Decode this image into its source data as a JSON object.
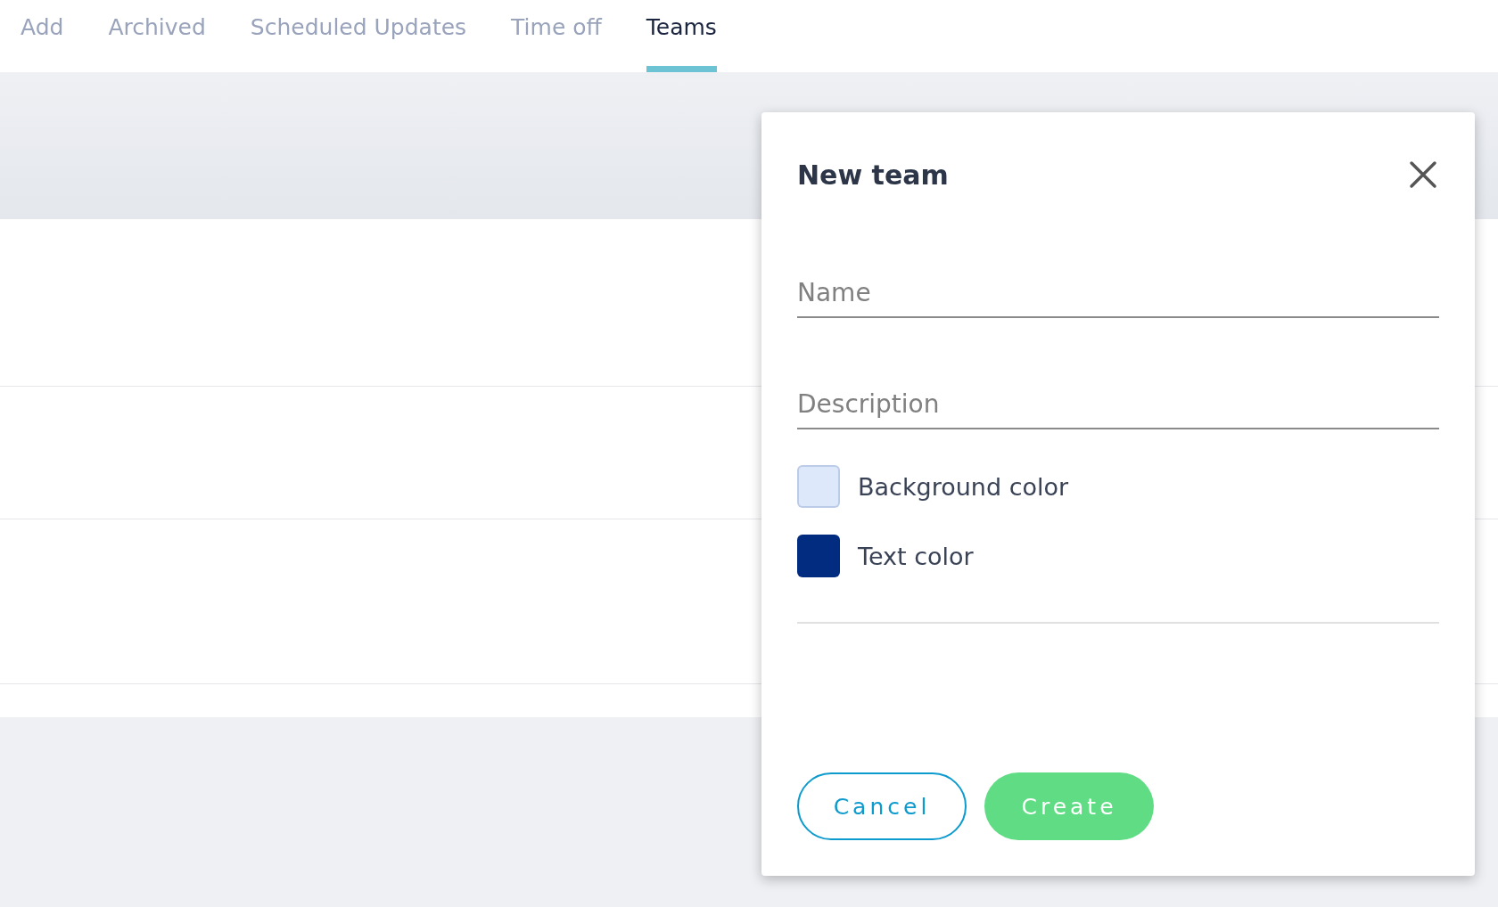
{
  "tabs": [
    {
      "label": "Add",
      "selected": false
    },
    {
      "label": "Archived",
      "selected": false
    },
    {
      "label": "Scheduled Updates",
      "selected": false
    },
    {
      "label": "Time off",
      "selected": false
    },
    {
      "label": "Teams",
      "selected": true
    }
  ],
  "dialog": {
    "title": "New team",
    "fields": [
      {
        "placeholder": "Name"
      },
      {
        "placeholder": "Description"
      }
    ],
    "colors": [
      {
        "label": "Background color",
        "color": "#dde8fb"
      },
      {
        "label": "Text color",
        "color": "#022c80"
      }
    ],
    "buttons": [
      {
        "label": "Cancel",
        "kind": "secondary"
      },
      {
        "label": "Create",
        "kind": "primary"
      }
    ]
  }
}
